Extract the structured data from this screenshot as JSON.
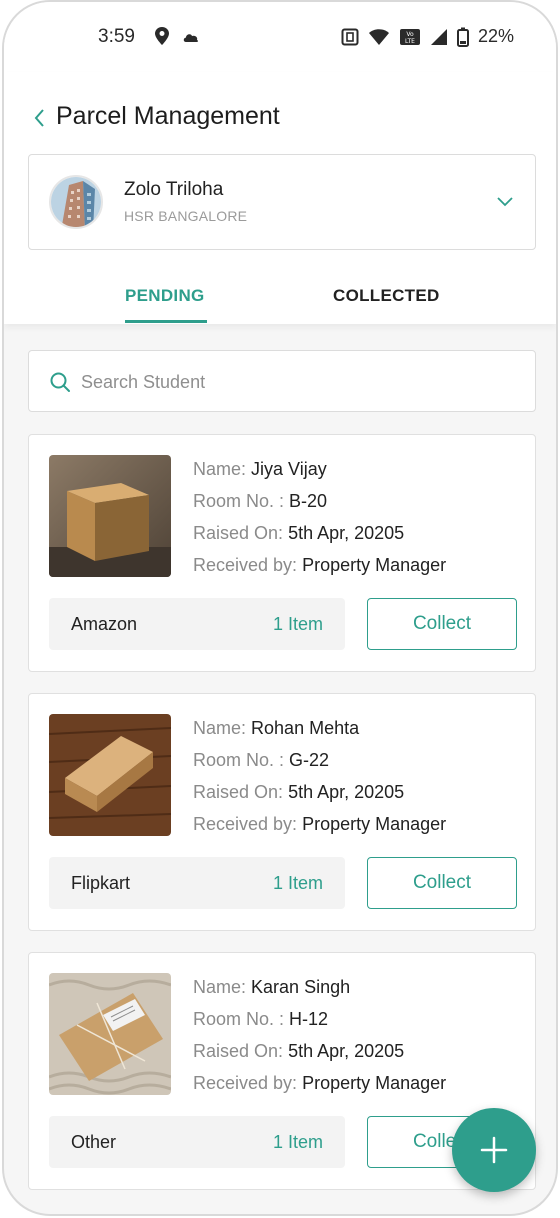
{
  "status_bar": {
    "time": "3:59",
    "battery": "22%"
  },
  "header": {
    "title": "Parcel Management"
  },
  "property": {
    "name": "Zolo Triloha",
    "location": "HSR BANGALORE"
  },
  "tabs": [
    {
      "label": "PENDING",
      "active": true
    },
    {
      "label": "COLLECTED",
      "active": false
    }
  ],
  "search": {
    "placeholder": "Search Student",
    "value": ""
  },
  "labels": {
    "name": "Name:",
    "room": "Room No. :",
    "raised": "Raised On:",
    "received": "Received by:"
  },
  "parcels": [
    {
      "name": "Jiya Vijay",
      "room": "B-20",
      "raised_on": "5th Apr, 20205",
      "received_by": "Property Manager",
      "source": "Amazon",
      "items": "1 Item",
      "action": "Collect",
      "image": "cardboard-box-photo"
    },
    {
      "name": "Rohan Mehta",
      "room": "G-22",
      "raised_on": "5th Apr, 20205",
      "received_by": "Property Manager",
      "source": "Flipkart",
      "items": "1 Item",
      "action": "Collect",
      "image": "box-on-wooden-table-photo"
    },
    {
      "name": "Karan Singh",
      "room": "H-12",
      "raised_on": "5th Apr, 20205",
      "received_by": "Property Manager",
      "source": "Other",
      "items": "1 Item",
      "action": "Collect",
      "image": "wrapped-parcel-photo"
    }
  ],
  "colors": {
    "accent": "#2e9e8c",
    "background": "#f6f6f6",
    "muted_text": "#8a8a8a"
  }
}
